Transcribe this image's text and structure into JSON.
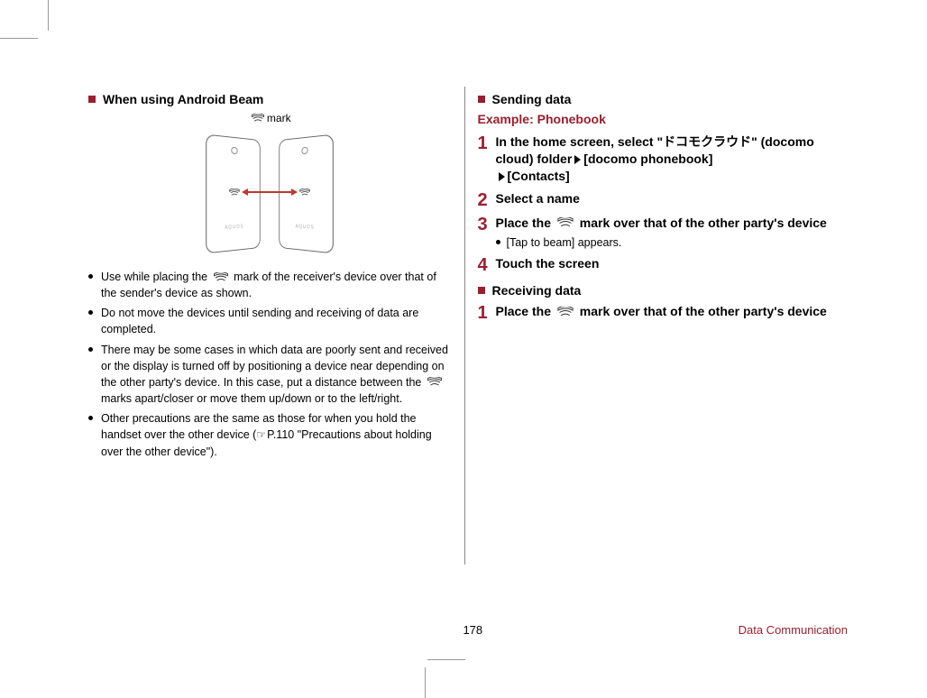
{
  "page_number": "178",
  "chapter": "Data Communication",
  "left": {
    "heading": "When using Android Beam",
    "mark_label": "mark",
    "bullets": {
      "b1a": "Use while placing the ",
      "b1b": " mark of the receiver's device over that of the sender's device as shown.",
      "b2": "Do not move the devices until sending and receiving of data are completed.",
      "b3a": "There may be some cases in which data are poorly sent and received or the display is turned off by positioning a device near depending on the other party's device. In this case, put a distance between the ",
      "b3b": " marks apart/closer or move them up/down or to the left/right.",
      "b4a": "Other precautions are the same as those for when you hold the handset over the other device (",
      "b4b": "P.110 \"Precautions about holding over the other device\")."
    }
  },
  "right": {
    "heading_send": "Sending data",
    "example": "Example: Phonebook",
    "step1a": "In the home screen, select",
    "step1_jp_open": "\"",
    "step1_jp": "ドコモクラウド",
    "step1_jp_close": "\"",
    "step1b": "(docomo cloud) folder",
    "step1c": "[docomo phonebook]",
    "step1d": "[Contacts]",
    "step2": "Select a name",
    "step3a": "Place the ",
    "step3b": " mark over that of the other party's device",
    "step3_sub": "[Tap to beam] appears.",
    "step4": "Touch the screen",
    "heading_recv": "Receiving data",
    "recv1a": "Place the ",
    "recv1b": " mark over that of the other party's device"
  }
}
